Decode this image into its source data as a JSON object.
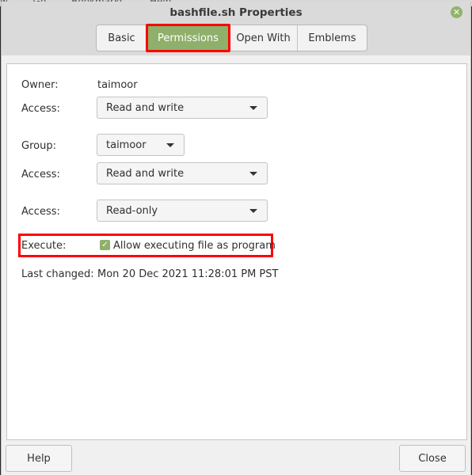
{
  "background_menu": [
    "w",
    "Go",
    "Bookmarks",
    "Help"
  ],
  "window": {
    "title": "bashfile.sh Properties",
    "close_icon": "close-icon",
    "accent_color": "#8fb06b"
  },
  "tabs": [
    {
      "label": "Basic",
      "active": false
    },
    {
      "label": "Permissions",
      "active": true
    },
    {
      "label": "Open With",
      "active": false
    },
    {
      "label": "Emblems",
      "active": false
    }
  ],
  "permissions": {
    "owner_label": "Owner:",
    "owner_value": "taimoor",
    "owner_access_label": "Access:",
    "owner_access_value": "Read and write",
    "group_label": "Group:",
    "group_value": "taimoor",
    "group_access_label": "Access:",
    "group_access_value": "Read and write",
    "others_access_label": "Access:",
    "others_access_value": "Read-only",
    "execute_label": "Execute:",
    "execute_checkbox_label": "Allow executing file as program",
    "execute_checked": true,
    "last_changed_label": "Last changed:",
    "last_changed_value": "Mon 20 Dec 2021 11:28:01 PM PST"
  },
  "footer": {
    "help_label": "Help",
    "close_label": "Close"
  }
}
